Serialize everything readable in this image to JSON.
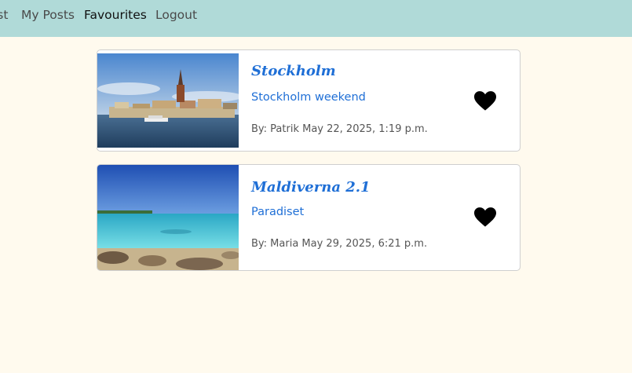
{
  "nav": {
    "items": [
      {
        "label": "Post"
      },
      {
        "label": "My Posts"
      },
      {
        "label": "Favourites"
      },
      {
        "label": "Logout"
      }
    ]
  },
  "posts": [
    {
      "title": "Stockholm",
      "excerpt": "Stockholm weekend",
      "meta": "By: Patrik May 22, 2025, 1:19 p.m.",
      "image_icon": "stockholm-photo",
      "favourite_icon": "heart-icon"
    },
    {
      "title": "Maldiverna 2.1",
      "excerpt": "Paradiset",
      "meta": "By: Maria May 29, 2025, 6:21 p.m.",
      "image_icon": "maldives-photo",
      "favourite_icon": "heart-icon"
    }
  ],
  "colors": {
    "navbar": "#b0dad8",
    "background": "#fffaee",
    "link": "#1f6fd6"
  }
}
